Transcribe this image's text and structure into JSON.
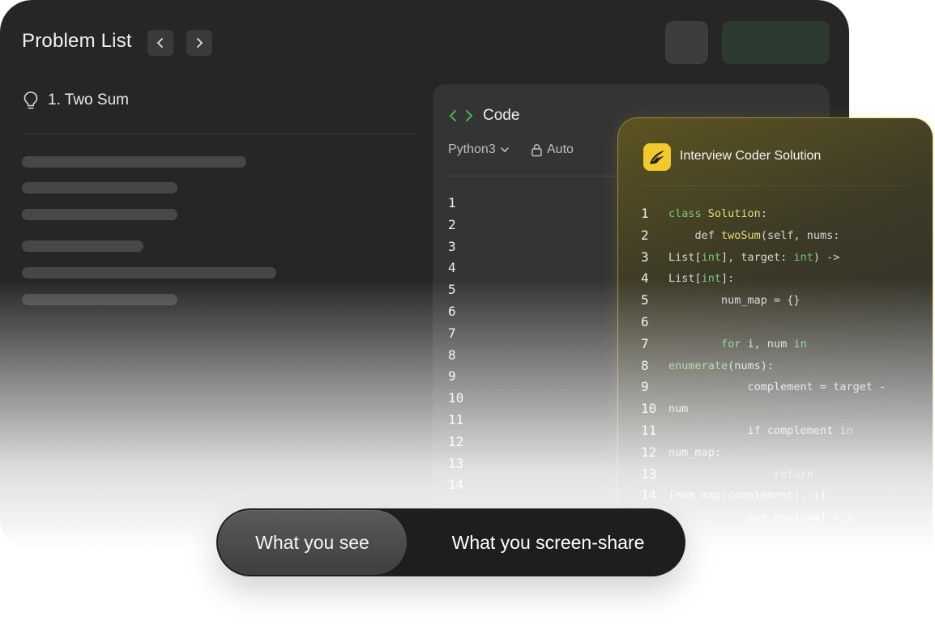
{
  "header": {
    "title": "Problem List"
  },
  "problem": {
    "title": "1. Two Sum"
  },
  "code_panel": {
    "title": "Code",
    "language": "Python3",
    "mode": "Auto",
    "line_numbers": [
      "1",
      "2",
      "3",
      "4",
      "5",
      "6",
      "7",
      "8",
      "9",
      "10",
      "11",
      "12",
      "13",
      "14"
    ]
  },
  "solution": {
    "title": "Interview Coder Solution",
    "line_numbers": [
      "1",
      "2",
      "3",
      "4",
      "5",
      "6",
      "7",
      "8",
      "9",
      "10",
      "11",
      "12",
      "13",
      "14"
    ],
    "code_lines": [
      [
        {
          "t": "class ",
          "c": "kw"
        },
        {
          "t": "Solution",
          "c": "fn"
        },
        {
          "t": ":",
          "c": ""
        }
      ],
      [
        {
          "t": "    def ",
          "c": ""
        },
        {
          "t": "twoSum",
          "c": "fn"
        },
        {
          "t": "(self, nums:",
          "c": ""
        }
      ],
      [
        {
          "t": "List[",
          "c": ""
        },
        {
          "t": "int",
          "c": "kw"
        },
        {
          "t": "], target: ",
          "c": ""
        },
        {
          "t": "int",
          "c": "kw"
        },
        {
          "t": ") ->",
          "c": ""
        }
      ],
      [
        {
          "t": "List[",
          "c": ""
        },
        {
          "t": "int",
          "c": "kw"
        },
        {
          "t": "]:",
          "c": ""
        }
      ],
      [
        {
          "t": "        num_map = {}",
          "c": ""
        }
      ],
      [
        {
          "t": "",
          "c": ""
        }
      ],
      [
        {
          "t": "        ",
          "c": ""
        },
        {
          "t": "for",
          "c": "kw"
        },
        {
          "t": " i, num ",
          "c": ""
        },
        {
          "t": "in",
          "c": "kw"
        }
      ],
      [
        {
          "t": "enumerate",
          "c": "kw"
        },
        {
          "t": "(nums):",
          "c": ""
        }
      ],
      [
        {
          "t": "            complement = target -",
          "c": ""
        }
      ],
      [
        {
          "t": "num",
          "c": ""
        }
      ],
      [
        {
          "t": "            if complement ",
          "c": ""
        },
        {
          "t": "in",
          "c": "kw"
        }
      ],
      [
        {
          "t": "num_map:",
          "c": ""
        }
      ],
      [
        {
          "t": "                ",
          "c": ""
        },
        {
          "t": "return",
          "c": "kw"
        }
      ],
      [
        {
          "t": "[num_map[complement], i]",
          "c": ""
        }
      ],
      [
        {
          "t": "            num_map[num] = i",
          "c": ""
        }
      ]
    ]
  },
  "toggle": {
    "active_label": "What you see",
    "other_label": "What you screen-share"
  },
  "colors": {
    "window_bg": "#262626",
    "panel_bg": "#343434",
    "accent_green": "#4caf50",
    "logo_yellow": "#f2c92d",
    "solution_border": "#e6cd46"
  }
}
